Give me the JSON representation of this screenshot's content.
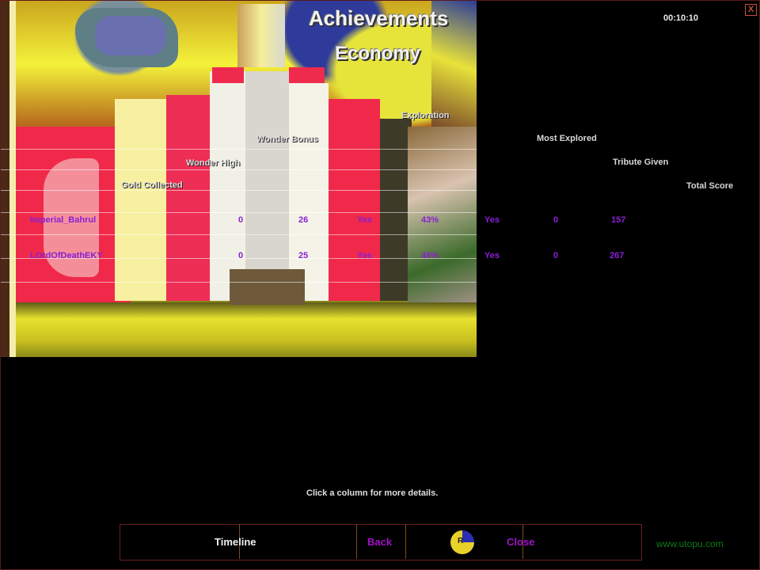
{
  "titles": {
    "achievements": "Achievements",
    "economy": "Economy"
  },
  "timer": "00:10:10",
  "close_glyph": "X",
  "columns": {
    "wonder_bonus": "Wonder Bonus",
    "wonder_high": "Wonder High",
    "gold_collected": "Gold Collected",
    "exploration": "Exploration",
    "most_explored": "Most Explored",
    "tribute_given": "Tribute Given",
    "total_score": "Total Score"
  },
  "players": [
    {
      "name": "Imperial_Bahrul",
      "wonder_high": "0",
      "wonder_bonus": "26",
      "exploration": "Yes",
      "pct": "43%",
      "most_explored": "Yes",
      "tribute_given": "0",
      "total_score": "157"
    },
    {
      "name": "LOrdOfDeathEKY",
      "wonder_high": "0",
      "wonder_bonus": "25",
      "exploration": "Yes",
      "pct": "45%",
      "most_explored": "Yes",
      "tribute_given": "0",
      "total_score": "267"
    }
  ],
  "hint": "Click a column for more details.",
  "buttons": {
    "timeline": "Timeline",
    "back": "Back",
    "close": "Close"
  },
  "spinner_label": "R",
  "footer": "www.utopu.com",
  "colors": {
    "player_value": "#8a1fd6",
    "button_link": "#a012c8",
    "footer": "#0f7a18",
    "frame": "#6a2020"
  }
}
